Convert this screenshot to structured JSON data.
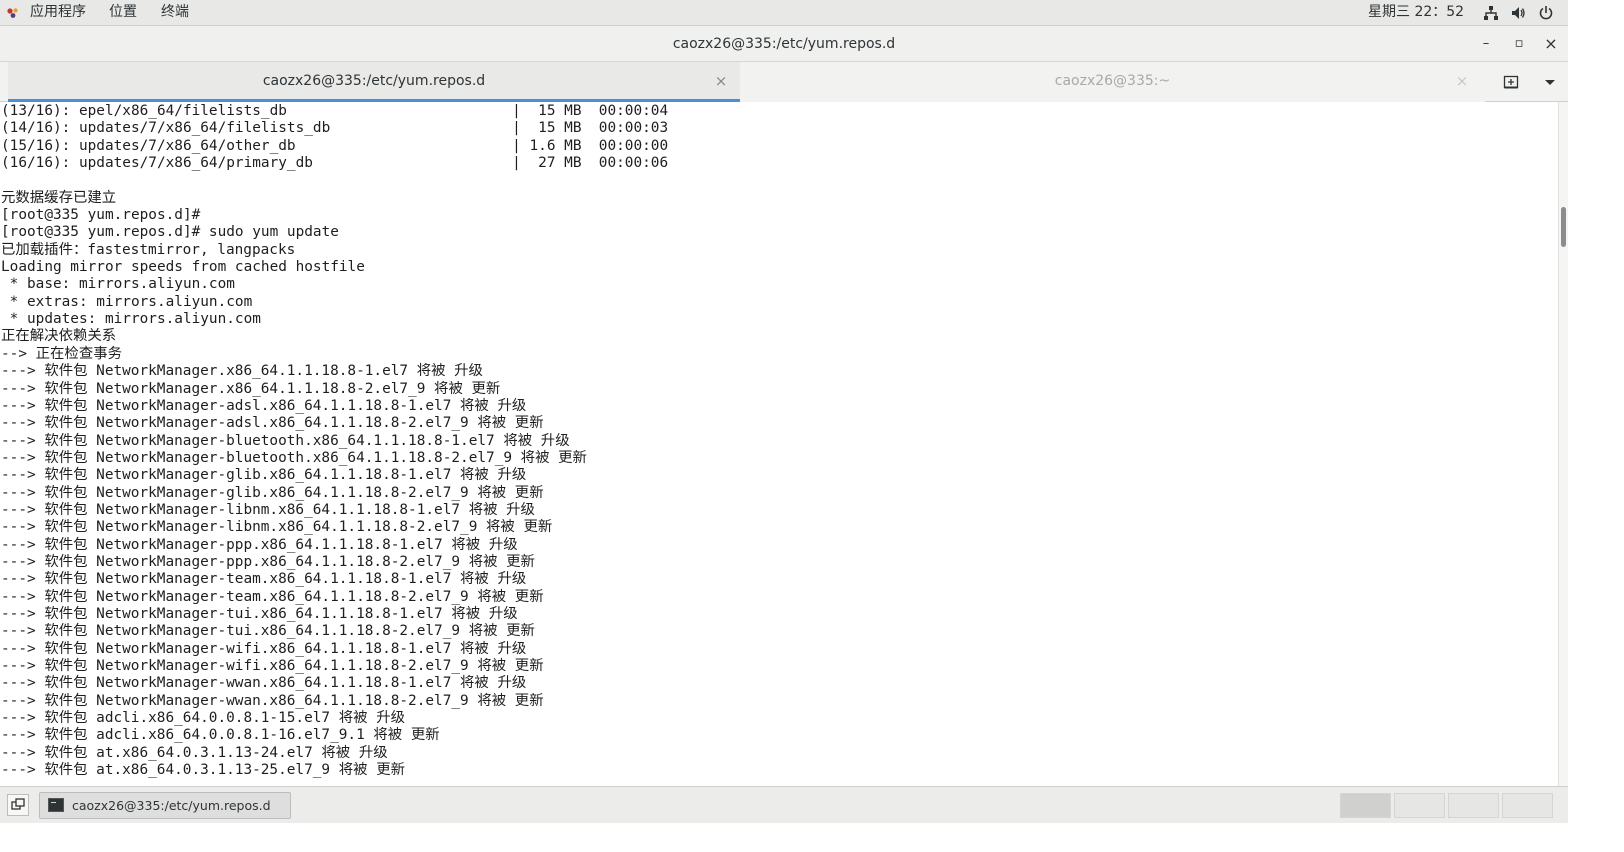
{
  "topbar": {
    "applications": "应用程序",
    "places": "位置",
    "terminal": "终端",
    "clock": "星期三 22：52",
    "icons": [
      "network-icon",
      "volume-icon",
      "power-icon"
    ]
  },
  "window": {
    "title": "caozx26@335:/etc/yum.repos.d",
    "buttons": {
      "minimize": "–",
      "maximize": "▫",
      "close": "×"
    }
  },
  "tabs": [
    {
      "label": "caozx26@335:/etc/yum.repos.d",
      "active": true,
      "close": "×"
    },
    {
      "label": "caozx26@335:~",
      "active": false,
      "close": "×"
    }
  ],
  "terminal": {
    "lines": [
      "(13/16): epel/x86_64/filelists_db                          |  15 MB  00:00:04",
      "(14/16): updates/7/x86_64/filelists_db                     |  15 MB  00:00:03",
      "(15/16): updates/7/x86_64/other_db                         | 1.6 MB  00:00:00",
      "(16/16): updates/7/x86_64/primary_db                       |  27 MB  00:00:06",
      "",
      "元数据缓存已建立",
      "[root@335 yum.repos.d]# ",
      "[root@335 yum.repos.d]# sudo yum update",
      "已加载插件：fastestmirror, langpacks",
      "Loading mirror speeds from cached hostfile",
      " * base: mirrors.aliyun.com",
      " * extras: mirrors.aliyun.com",
      " * updates: mirrors.aliyun.com",
      "正在解决依赖关系",
      "--> 正在检查事务",
      "---> 软件包 NetworkManager.x86_64.1.1.18.8-1.el7 将被 升级",
      "---> 软件包 NetworkManager.x86_64.1.1.18.8-2.el7_9 将被 更新",
      "---> 软件包 NetworkManager-adsl.x86_64.1.1.18.8-1.el7 将被 升级",
      "---> 软件包 NetworkManager-adsl.x86_64.1.1.18.8-2.el7_9 将被 更新",
      "---> 软件包 NetworkManager-bluetooth.x86_64.1.1.18.8-1.el7 将被 升级",
      "---> 软件包 NetworkManager-bluetooth.x86_64.1.1.18.8-2.el7_9 将被 更新",
      "---> 软件包 NetworkManager-glib.x86_64.1.1.18.8-1.el7 将被 升级",
      "---> 软件包 NetworkManager-glib.x86_64.1.1.18.8-2.el7_9 将被 更新",
      "---> 软件包 NetworkManager-libnm.x86_64.1.1.18.8-1.el7 将被 升级",
      "---> 软件包 NetworkManager-libnm.x86_64.1.1.18.8-2.el7_9 将被 更新",
      "---> 软件包 NetworkManager-ppp.x86_64.1.1.18.8-1.el7 将被 升级",
      "---> 软件包 NetworkManager-ppp.x86_64.1.1.18.8-2.el7_9 将被 更新",
      "---> 软件包 NetworkManager-team.x86_64.1.1.18.8-1.el7 将被 升级",
      "---> 软件包 NetworkManager-team.x86_64.1.1.18.8-2.el7_9 将被 更新",
      "---> 软件包 NetworkManager-tui.x86_64.1.1.18.8-1.el7 将被 升级",
      "---> 软件包 NetworkManager-tui.x86_64.1.1.18.8-2.el7_9 将被 更新",
      "---> 软件包 NetworkManager-wifi.x86_64.1.1.18.8-1.el7 将被 升级",
      "---> 软件包 NetworkManager-wifi.x86_64.1.1.18.8-2.el7_9 将被 更新",
      "---> 软件包 NetworkManager-wwan.x86_64.1.1.18.8-1.el7 将被 升级",
      "---> 软件包 NetworkManager-wwan.x86_64.1.1.18.8-2.el7_9 将被 更新",
      "---> 软件包 adcli.x86_64.0.0.8.1-15.el7 将被 升级",
      "---> 软件包 adcli.x86_64.0.0.8.1-16.el7_9.1 将被 更新",
      "---> 软件包 at.x86_64.0.3.1.13-24.el7 将被 升级",
      "---> 软件包 at.x86_64.0.3.1.13-25.el7_9 将被 更新"
    ]
  },
  "taskbar": {
    "window_label": "caozx26@335:/etc/yum.repos.d",
    "workspaces": 4,
    "active_workspace": 1
  },
  "colors": {
    "accent": "#4a90d9",
    "terminal_bg": "#ffffff",
    "terminal_fg": "#1e1e1e",
    "panel_bg": "#e8e8e7"
  }
}
